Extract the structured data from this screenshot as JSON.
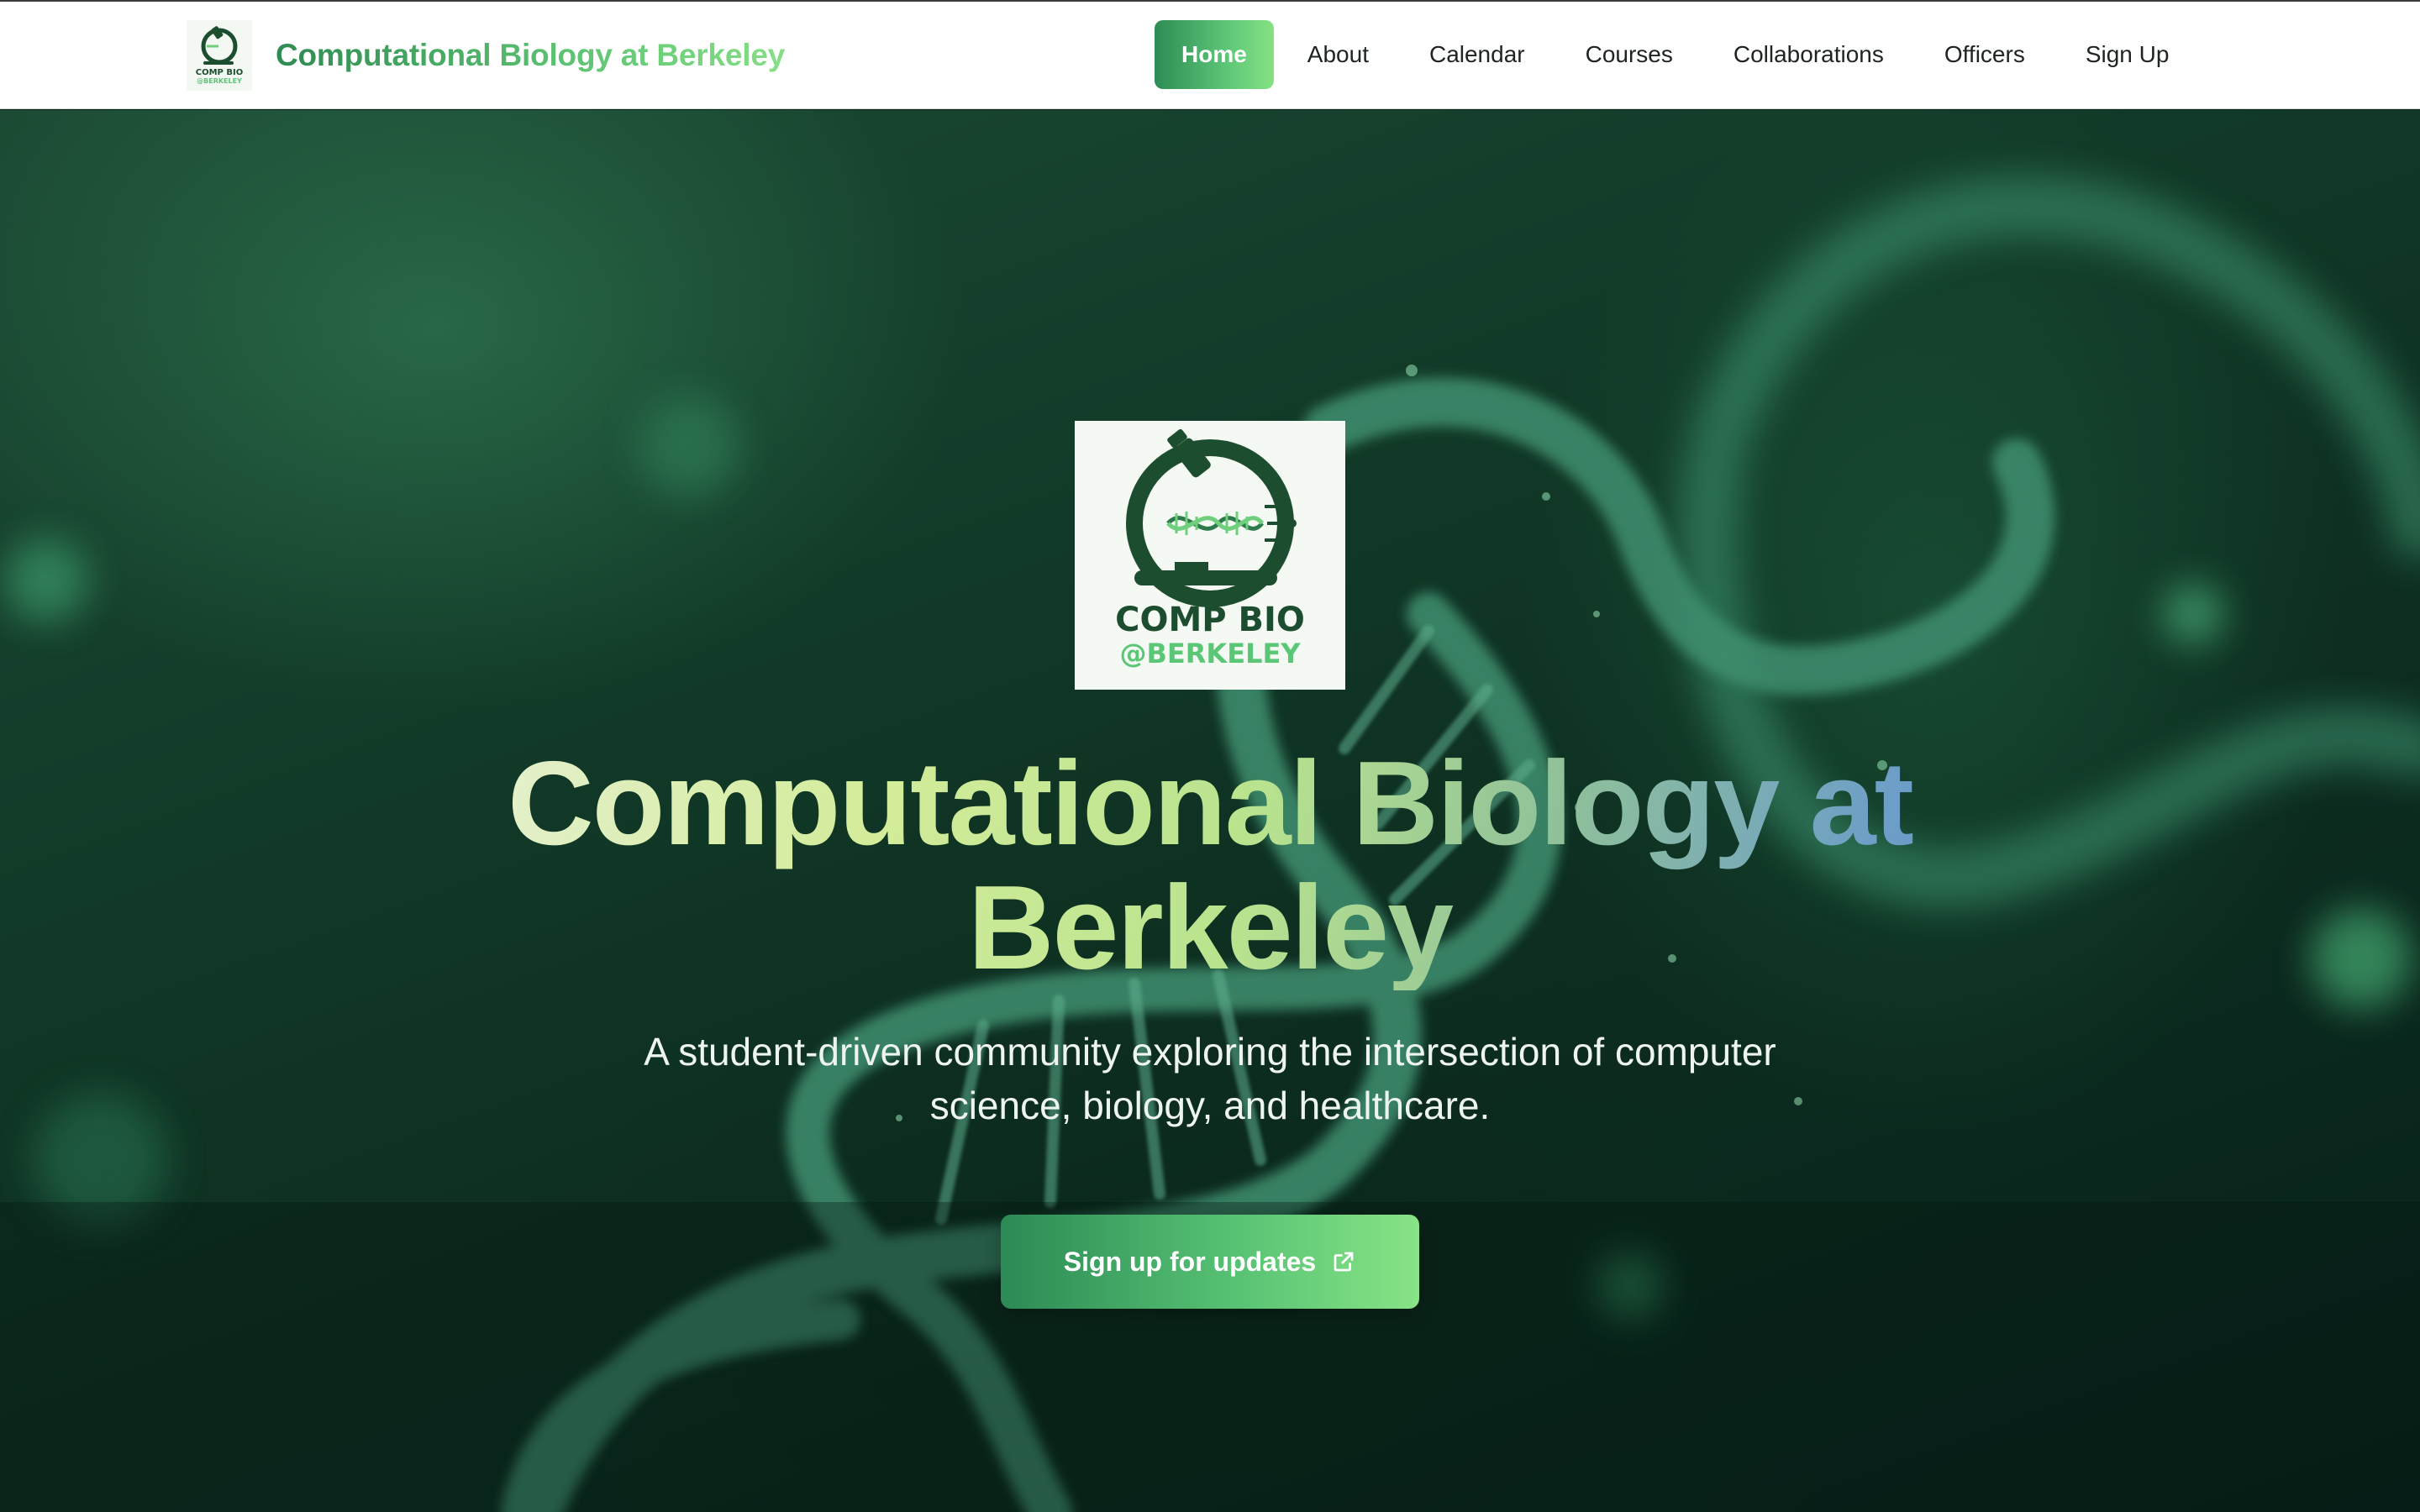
{
  "header": {
    "brand_name": "Computational Biology at Berkeley",
    "logo_text_top": "COMP BIO",
    "logo_text_bottom": "@BERKELEY"
  },
  "nav": {
    "items": [
      {
        "label": "Home",
        "active": true
      },
      {
        "label": "About",
        "active": false
      },
      {
        "label": "Calendar",
        "active": false
      },
      {
        "label": "Courses",
        "active": false
      },
      {
        "label": "Collaborations",
        "active": false
      },
      {
        "label": "Officers",
        "active": false
      },
      {
        "label": "Sign Up",
        "active": false
      }
    ]
  },
  "hero": {
    "logo_text_top": "COMP BIO",
    "logo_text_bottom": "@BERKELEY",
    "title": "Computational Biology at Berkeley",
    "subtitle": "A student-driven community exploring the intersection of computer science, biology, and healthcare.",
    "cta_label": "Sign up for updates",
    "cta_icon": "external-link-icon",
    "background_image": "dna-double-helix"
  },
  "colors": {
    "brand_green_dark": "#2e8c54",
    "brand_green_light": "#86e283",
    "logo_green_dark": "#1d4d2f",
    "hero_bg": "#123a28",
    "title_blue": "#5f92cf"
  }
}
